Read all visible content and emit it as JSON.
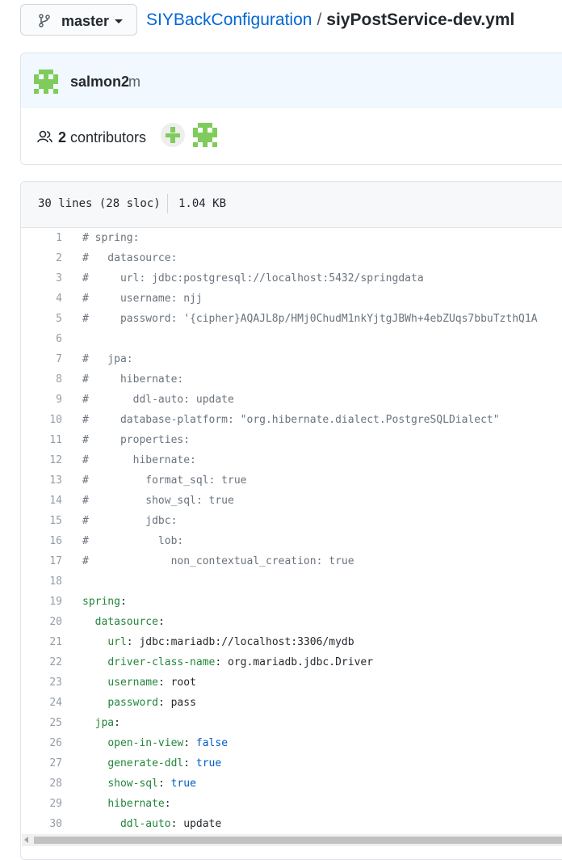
{
  "branch": {
    "label": "master",
    "icon": "git-branch-icon"
  },
  "breadcrumb": {
    "repo": "SIYBackConfiguration",
    "separator": "/",
    "file": "siyPostService-dev.yml"
  },
  "commit": {
    "author": "salmon2",
    "message": "m"
  },
  "contributors": {
    "count": "2",
    "label": "contributors"
  },
  "file_info": {
    "lines": "30 lines (28 sloc)",
    "size": "1.04 KB"
  },
  "colors": {
    "link": "#0366d6",
    "key": "#22863a",
    "bool": "#005cc5",
    "comment": "#6a737d",
    "avatar_green": "#7fcc5c"
  },
  "code": [
    {
      "n": "1",
      "text": "# spring:"
    },
    {
      "n": "2",
      "text": "#   datasource:"
    },
    {
      "n": "3",
      "text": "#     url: jdbc:postgresql://localhost:5432/springdata"
    },
    {
      "n": "4",
      "text": "#     username: njj"
    },
    {
      "n": "5",
      "text": "#     password: '{cipher}AQAJL8p/HMj0ChudM1nkYjtgJBWh+4ebZUqs7bbuTzthQ1A"
    },
    {
      "n": "6",
      "text": ""
    },
    {
      "n": "7",
      "text": "#   jpa:"
    },
    {
      "n": "8",
      "text": "#     hibernate:"
    },
    {
      "n": "9",
      "text": "#       ddl-auto: update"
    },
    {
      "n": "10",
      "text": "#     database-platform: \"org.hibernate.dialect.PostgreSQLDialect\""
    },
    {
      "n": "11",
      "text": "#     properties:"
    },
    {
      "n": "12",
      "text": "#       hibernate:"
    },
    {
      "n": "13",
      "text": "#         format_sql: true"
    },
    {
      "n": "14",
      "text": "#         show_sql: true"
    },
    {
      "n": "15",
      "text": "#         jdbc:"
    },
    {
      "n": "16",
      "text": "#           lob:"
    },
    {
      "n": "17",
      "text": "#             non_contextual_creation: true"
    },
    {
      "n": "18",
      "text": ""
    },
    {
      "n": "19",
      "indent": "",
      "key": "spring",
      "value": ""
    },
    {
      "n": "20",
      "indent": "  ",
      "key": "datasource",
      "value": ""
    },
    {
      "n": "21",
      "indent": "    ",
      "key": "url",
      "value": "jdbc:mariadb://localhost:3306/mydb"
    },
    {
      "n": "22",
      "indent": "    ",
      "key": "driver-class-name",
      "value": "org.mariadb.jdbc.Driver"
    },
    {
      "n": "23",
      "indent": "    ",
      "key": "username",
      "value": "root"
    },
    {
      "n": "24",
      "indent": "    ",
      "key": "password",
      "value": "pass"
    },
    {
      "n": "25",
      "indent": "  ",
      "key": "jpa",
      "value": ""
    },
    {
      "n": "26",
      "indent": "    ",
      "key": "open-in-view",
      "value": "false",
      "bool": true
    },
    {
      "n": "27",
      "indent": "    ",
      "key": "generate-ddl",
      "value": "true",
      "bool": true
    },
    {
      "n": "28",
      "indent": "    ",
      "key": "show-sql",
      "value": "true",
      "bool": true
    },
    {
      "n": "29",
      "indent": "    ",
      "key": "hibernate",
      "value": ""
    },
    {
      "n": "30",
      "indent": "      ",
      "key": "ddl-auto",
      "value": "update"
    }
  ]
}
